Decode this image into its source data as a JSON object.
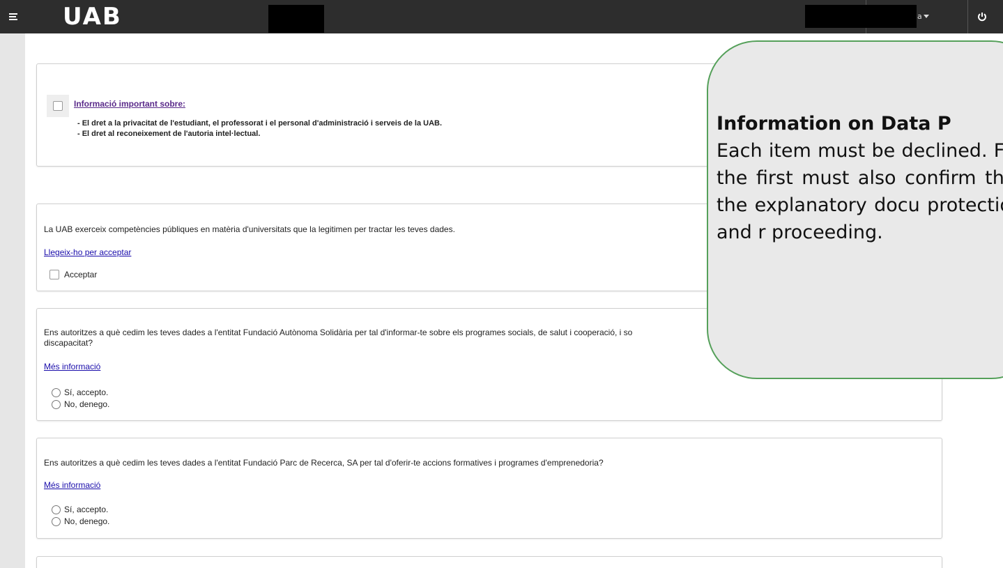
{
  "header": {
    "logo": "UAB",
    "user_label": "ia",
    "menu_icon": "hamburger-icon",
    "power_icon": "power-icon"
  },
  "privacy_card": {
    "link": "Informació important sobre:",
    "line1": "- El dret a la privacitat de l'estudiant, el professorat i el personal d'administració i serveis de la UAB.",
    "line2": "- El dret al reconeixement de l'autoria intel·lectual."
  },
  "card_legal": {
    "text": "La UAB exerceix competències públiques en matèria d'universitats que la legitimen per tractar les teves dades.",
    "link": "Llegeix-ho per acceptar",
    "checkbox_label": "Acceptar"
  },
  "card_fundacio": {
    "text_line1": "Ens autoritzes a què cedim les teves dades a l'entitat Fundació Autònoma Solidària per tal d'informar-te sobre els programes socials, de salut i cooperació, i so",
    "text_line2": "discapacitat?",
    "link": "Més informació",
    "option_yes": "Sí, accepto.",
    "option_no": "No, denego."
  },
  "card_parc": {
    "text": "Ens autoritzes a què cedim les teves dades a l'entitat Fundació Parc de Recerca, SA per tal d'oferir-te accions formatives i programes d'emprenedoria?",
    "link": "Més informació",
    "option_yes": "Sí, accepto.",
    "option_no": "No, denego."
  },
  "callout": {
    "title": "Information on Data P",
    "body": "Each item must be declined. For the first must also confirm that the explanatory docu protection and r proceeding."
  },
  "colors": {
    "topbar": "#2d2d2d",
    "callout_border": "#55a05a",
    "link": "#1a0dab"
  }
}
